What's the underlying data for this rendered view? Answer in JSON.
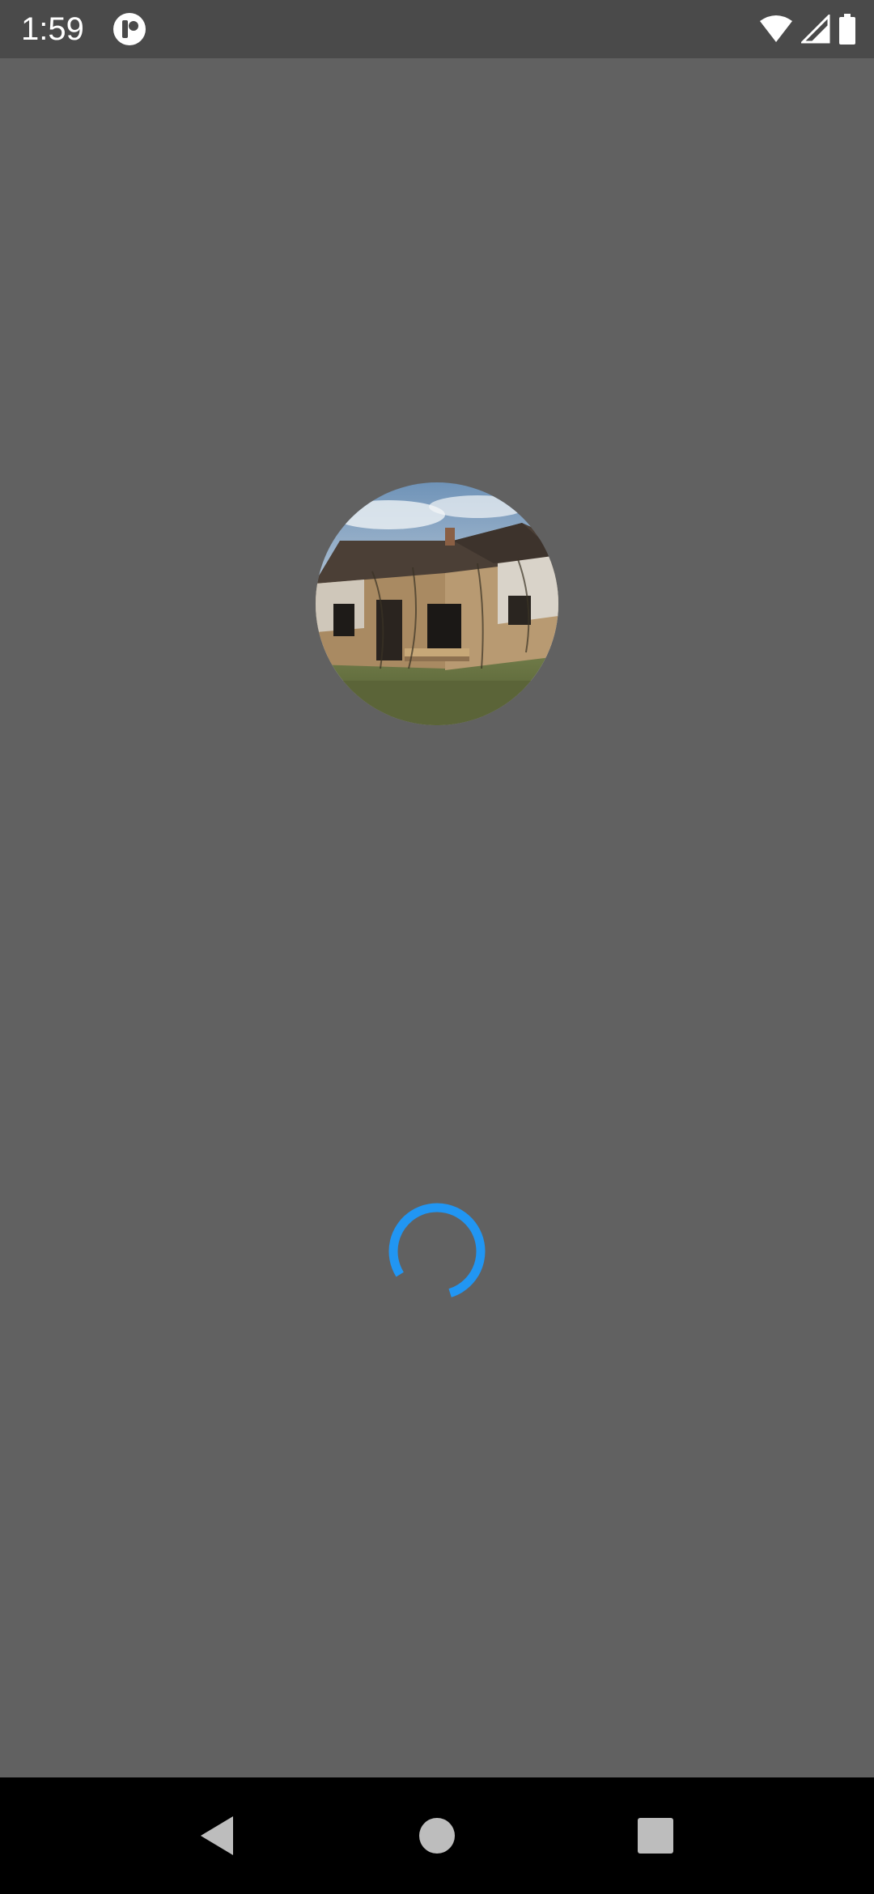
{
  "status_bar": {
    "time": "1:59",
    "icons": [
      "app-notification-icon",
      "wifi-icon",
      "signal-icon",
      "battery-icon"
    ]
  },
  "main": {
    "avatar_image": "abandoned-house-photo",
    "loading": true,
    "spinner_color": "#2196F3"
  },
  "navigation": {
    "buttons": [
      "back-icon",
      "home-icon",
      "recents-icon"
    ]
  },
  "colors": {
    "background": "#616161",
    "status_bar": "#4a4a4a",
    "nav_bar": "#000000",
    "accent": "#2196F3"
  }
}
